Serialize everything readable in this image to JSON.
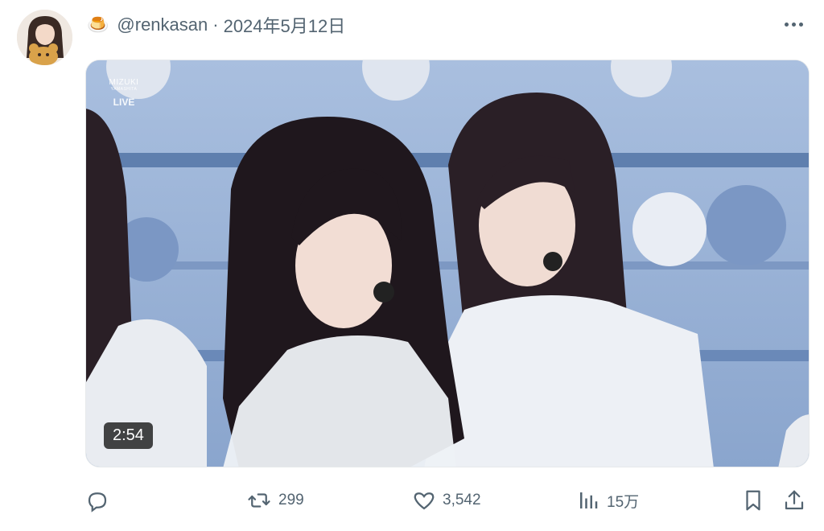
{
  "tweet": {
    "emoji": "🍮",
    "handle": "@renkasan",
    "separator": "·",
    "date": "2024年5月12日"
  },
  "media": {
    "watermark_brand": "MIZUKI",
    "watermark_sub": "YAMASHITA",
    "watermark_live": "LIVE",
    "duration": "2:54"
  },
  "actions": {
    "retweets": "299",
    "likes": "3,542",
    "views": "15万"
  },
  "icons": [
    "more-icon",
    "reply-icon",
    "retweet-icon",
    "like-icon",
    "views-icon",
    "bookmark-icon",
    "share-icon"
  ],
  "colors": {
    "meta_text": "#536471",
    "stage_blue": "#9db4d6"
  }
}
